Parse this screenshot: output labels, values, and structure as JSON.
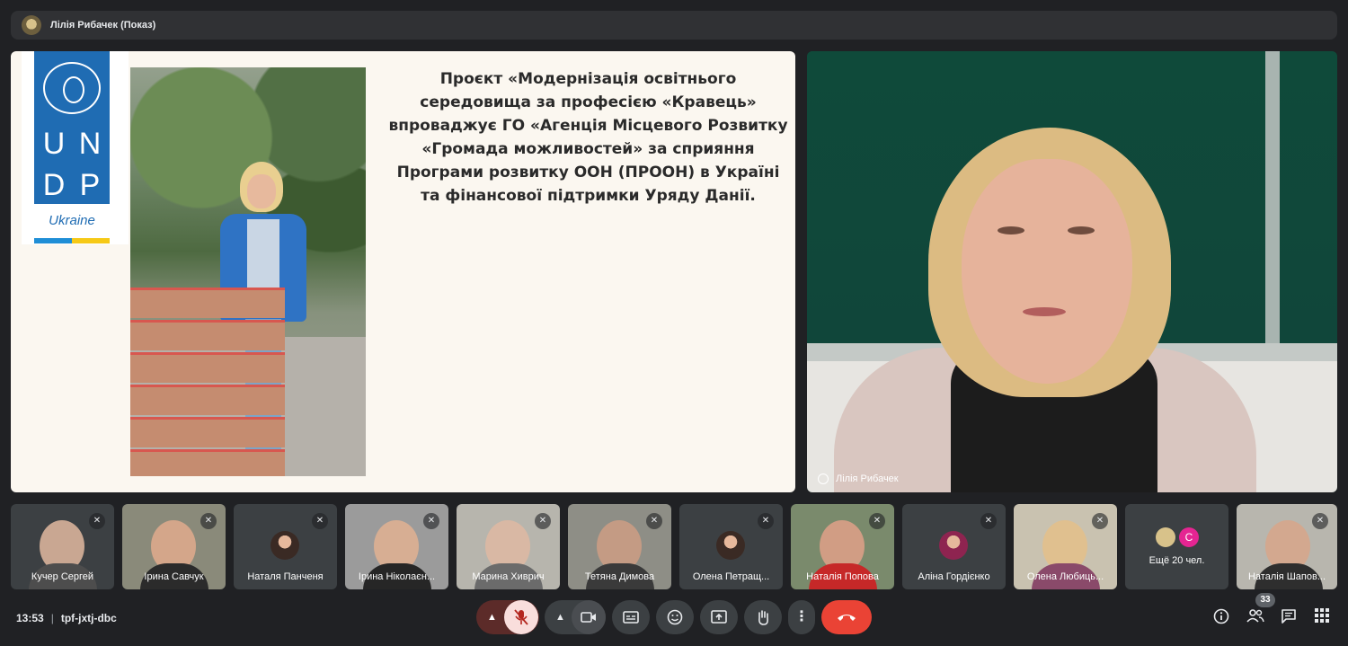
{
  "presentation_bar": {
    "title": "Лілія Рибачек (Показ)",
    "icon": "presenter-avatar-icon"
  },
  "slide": {
    "logo_letters": [
      "U",
      "N",
      "D",
      "P"
    ],
    "logo_country": "Ukraine",
    "text_lines": [
      "Проєкт «Модернізація освітнього",
      "середовища за професією «Кравець»",
      "впроваджує ГО «Агенція Місцевого Розвитку",
      "«Громада можливостей» за сприяння",
      "Програми розвитку ООН (ПРООН) в Україні",
      "та фінансової підтримки Уряду Данії."
    ]
  },
  "speaker": {
    "name": "Лілія Рибачек"
  },
  "participants": [
    {
      "name": "Кучер Сергей",
      "type": "video"
    },
    {
      "name": "Ірина Савчук",
      "type": "video"
    },
    {
      "name": "Наталя Панченя",
      "type": "avatar"
    },
    {
      "name": "Ірина Ніколаєн...",
      "type": "video"
    },
    {
      "name": "Марина Хиврич",
      "type": "video"
    },
    {
      "name": "Тетяна Димова",
      "type": "video"
    },
    {
      "name": "Олена Петращ...",
      "type": "avatar"
    },
    {
      "name": "Наталія Попова",
      "type": "video"
    },
    {
      "name": "Аліна Гордієнко",
      "type": "avatar"
    },
    {
      "name": "Олена Любиць...",
      "type": "video"
    },
    {
      "name": "Ещё 20 чел.",
      "type": "more",
      "avatar_letter": "С"
    },
    {
      "name": "Наталія Шапов...",
      "type": "video"
    }
  ],
  "bottom_bar": {
    "time": "13:53",
    "separator": "|",
    "meeting_code": "tpf-jxtj-dbc",
    "participant_count": "33",
    "controls": [
      "chevron-up-icon",
      "mic-off-icon",
      "chevron-up-icon",
      "camera-icon",
      "captions-icon",
      "emoji-icon",
      "present-screen-icon",
      "raise-hand-icon",
      "more-vert-icon",
      "end-call-icon"
    ],
    "right_icons": [
      "info-icon",
      "people-icon",
      "chat-icon",
      "activities-icon"
    ]
  },
  "colors": {
    "background": "#202124",
    "surface": "#3c4043",
    "end_call": "#ea4335",
    "undp_blue": "#1f6cb3"
  }
}
